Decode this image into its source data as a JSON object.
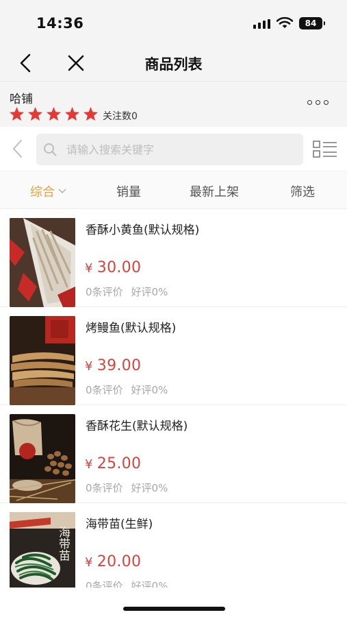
{
  "status_bar": {
    "time": "14:36",
    "battery": "84"
  },
  "nav": {
    "title": "商品列表"
  },
  "shop": {
    "name": "哈铺",
    "rating": 5,
    "follow_label": "关注数",
    "follow_count": "0",
    "star_color": "#e53935"
  },
  "search": {
    "placeholder": "请输入搜索关键字",
    "value": ""
  },
  "sort_tabs": [
    {
      "label": "综合",
      "active": true
    },
    {
      "label": "销量",
      "active": false
    },
    {
      "label": "最新上架",
      "active": false
    },
    {
      "label": "筛选",
      "active": false
    }
  ],
  "products": [
    {
      "name": "香酥小黄鱼(默认规格)",
      "currency": "¥",
      "price": "30.00",
      "reviews": "0条评价",
      "good_rate": "好评0%",
      "image": "dried-fish-photo"
    },
    {
      "name": "烤鳗鱼(默认规格)",
      "currency": "¥",
      "price": "39.00",
      "reviews": "0条评价",
      "good_rate": "好评0%",
      "image": "roasted-eel-photo"
    },
    {
      "name": "香酥花生(默认规格)",
      "currency": "¥",
      "price": "25.00",
      "reviews": "0条评价",
      "good_rate": "好评0%",
      "image": "crispy-peanut-photo"
    },
    {
      "name": "海带苗(生鲜)",
      "currency": "¥",
      "price": "20.00",
      "reviews": "0条评价",
      "good_rate": "好评0%",
      "image": "kelp-sprout-photo",
      "image_text": "海带苗"
    }
  ],
  "colors": {
    "accent": "#e9a23a",
    "price": "#d9433d",
    "meta": "#a8a8a8",
    "bar_bg": "#f4f4f4"
  }
}
